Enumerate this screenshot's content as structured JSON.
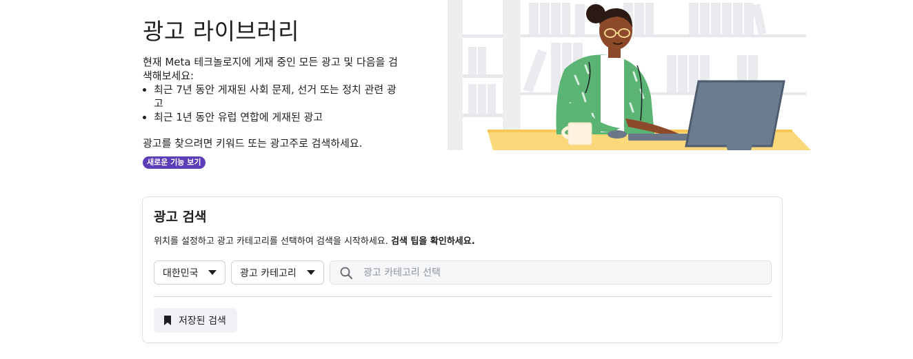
{
  "hero": {
    "title": "광고 라이브러리",
    "intro": "현재 Meta 테크놀로지에 게재 중인 모든 광고 및 다음을 검색해보세요:",
    "bullets": [
      "최근 7년 동안 게재된 사회 문제, 선거 또는 정치 관련 광고",
      "최근 1년 동안 유럽 연합에 게재된 광고"
    ],
    "hint": "광고를 찾으려면 키워드 또는 광고주로 검색하세요.",
    "new_features_badge": "새로운 기능 보기"
  },
  "search_card": {
    "title": "광고 검색",
    "subtitle": "위치를 설정하고 광고 카테고리를 선택하여 검색을 시작하세요.",
    "tips_link": "검색 팁을 확인하세요.",
    "country_dropdown": {
      "selected": "대한민국"
    },
    "category_dropdown": {
      "selected": "광고 카테고리"
    },
    "search_input": {
      "value": "",
      "placeholder": "광고 카테고리 선택"
    },
    "saved_searches_button": "저장된 검색"
  },
  "icons": {
    "search": "search-icon",
    "bookmark": "bookmark-icon",
    "dropdown": "caret-down-icon"
  },
  "colors": {
    "badge": "#5b3eb8",
    "card_border": "#dddfe2",
    "input_bg": "#f5f6f7",
    "button_bg": "#f0f2f5"
  }
}
